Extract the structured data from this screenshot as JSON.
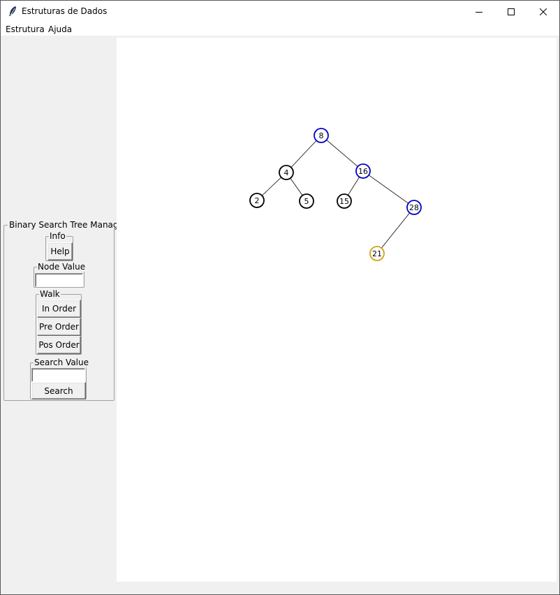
{
  "window": {
    "title": "Estruturas de Dados",
    "icon": "feather-icon"
  },
  "menu": {
    "items": [
      "Estrutura",
      "Ajuda"
    ]
  },
  "panel": {
    "title": "Binary Search Tree Manager",
    "info": {
      "legend": "Info",
      "help_label": "Help"
    },
    "node_value": {
      "legend": "Node Value",
      "value": ""
    },
    "walk": {
      "legend": "Walk",
      "buttons": [
        "In Order",
        "Pre Order",
        "Pos Order"
      ]
    },
    "search": {
      "legend": "Search Value",
      "value": "",
      "button_label": "Search"
    }
  },
  "tree": {
    "colors": {
      "default": "#000000",
      "path": "#0000cc",
      "found": "#d4a017"
    },
    "nodes": [
      {
        "value": "8",
        "status": "path"
      },
      {
        "value": "4",
        "status": "default"
      },
      {
        "value": "16",
        "status": "path"
      },
      {
        "value": "2",
        "status": "default"
      },
      {
        "value": "5",
        "status": "default"
      },
      {
        "value": "15",
        "status": "default"
      },
      {
        "value": "28",
        "status": "path"
      },
      {
        "value": "21",
        "status": "found"
      }
    ],
    "edges": [
      [
        "8",
        "4"
      ],
      [
        "8",
        "16"
      ],
      [
        "4",
        "2"
      ],
      [
        "4",
        "5"
      ],
      [
        "16",
        "15"
      ],
      [
        "16",
        "28"
      ],
      [
        "28",
        "21"
      ]
    ]
  }
}
